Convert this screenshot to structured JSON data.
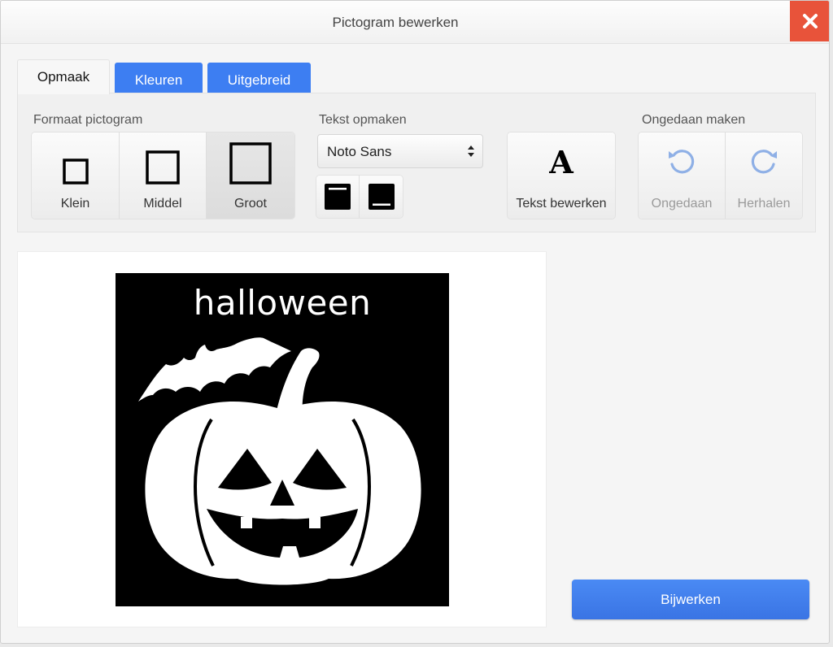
{
  "dialog": {
    "title": "Pictogram bewerken",
    "close_icon": "close-icon"
  },
  "tabs": [
    {
      "label": "Opmaak",
      "active": true
    },
    {
      "label": "Kleuren",
      "active": false
    },
    {
      "label": "Uitgebreid",
      "active": false
    }
  ],
  "toolbar": {
    "size_group": {
      "label": "Formaat pictogram",
      "options": [
        {
          "label": "Klein",
          "icon": "small-square-icon",
          "selected": false
        },
        {
          "label": "Middel",
          "icon": "medium-square-icon",
          "selected": false
        },
        {
          "label": "Groot",
          "icon": "large-square-icon",
          "selected": true
        }
      ]
    },
    "text_group": {
      "label": "Tekst opmaken",
      "font_value": "Noto Sans",
      "position_icons": [
        "text-top-icon",
        "text-bottom-icon"
      ]
    },
    "edit_text": {
      "label": "Tekst bewerken",
      "icon": "letter-a-icon"
    },
    "undo_group": {
      "label": "Ongedaan maken",
      "undo_label": "Ongedaan",
      "redo_label": "Herhalen"
    }
  },
  "preview": {
    "pictogram_text": "halloween",
    "image_icon": "pumpkin-bat-icon"
  },
  "actions": {
    "update_label": "Bijwerken"
  },
  "colors": {
    "accent": "#3d7ef2",
    "close": "#e8533a",
    "undo_icon": "#8fb0e6"
  }
}
